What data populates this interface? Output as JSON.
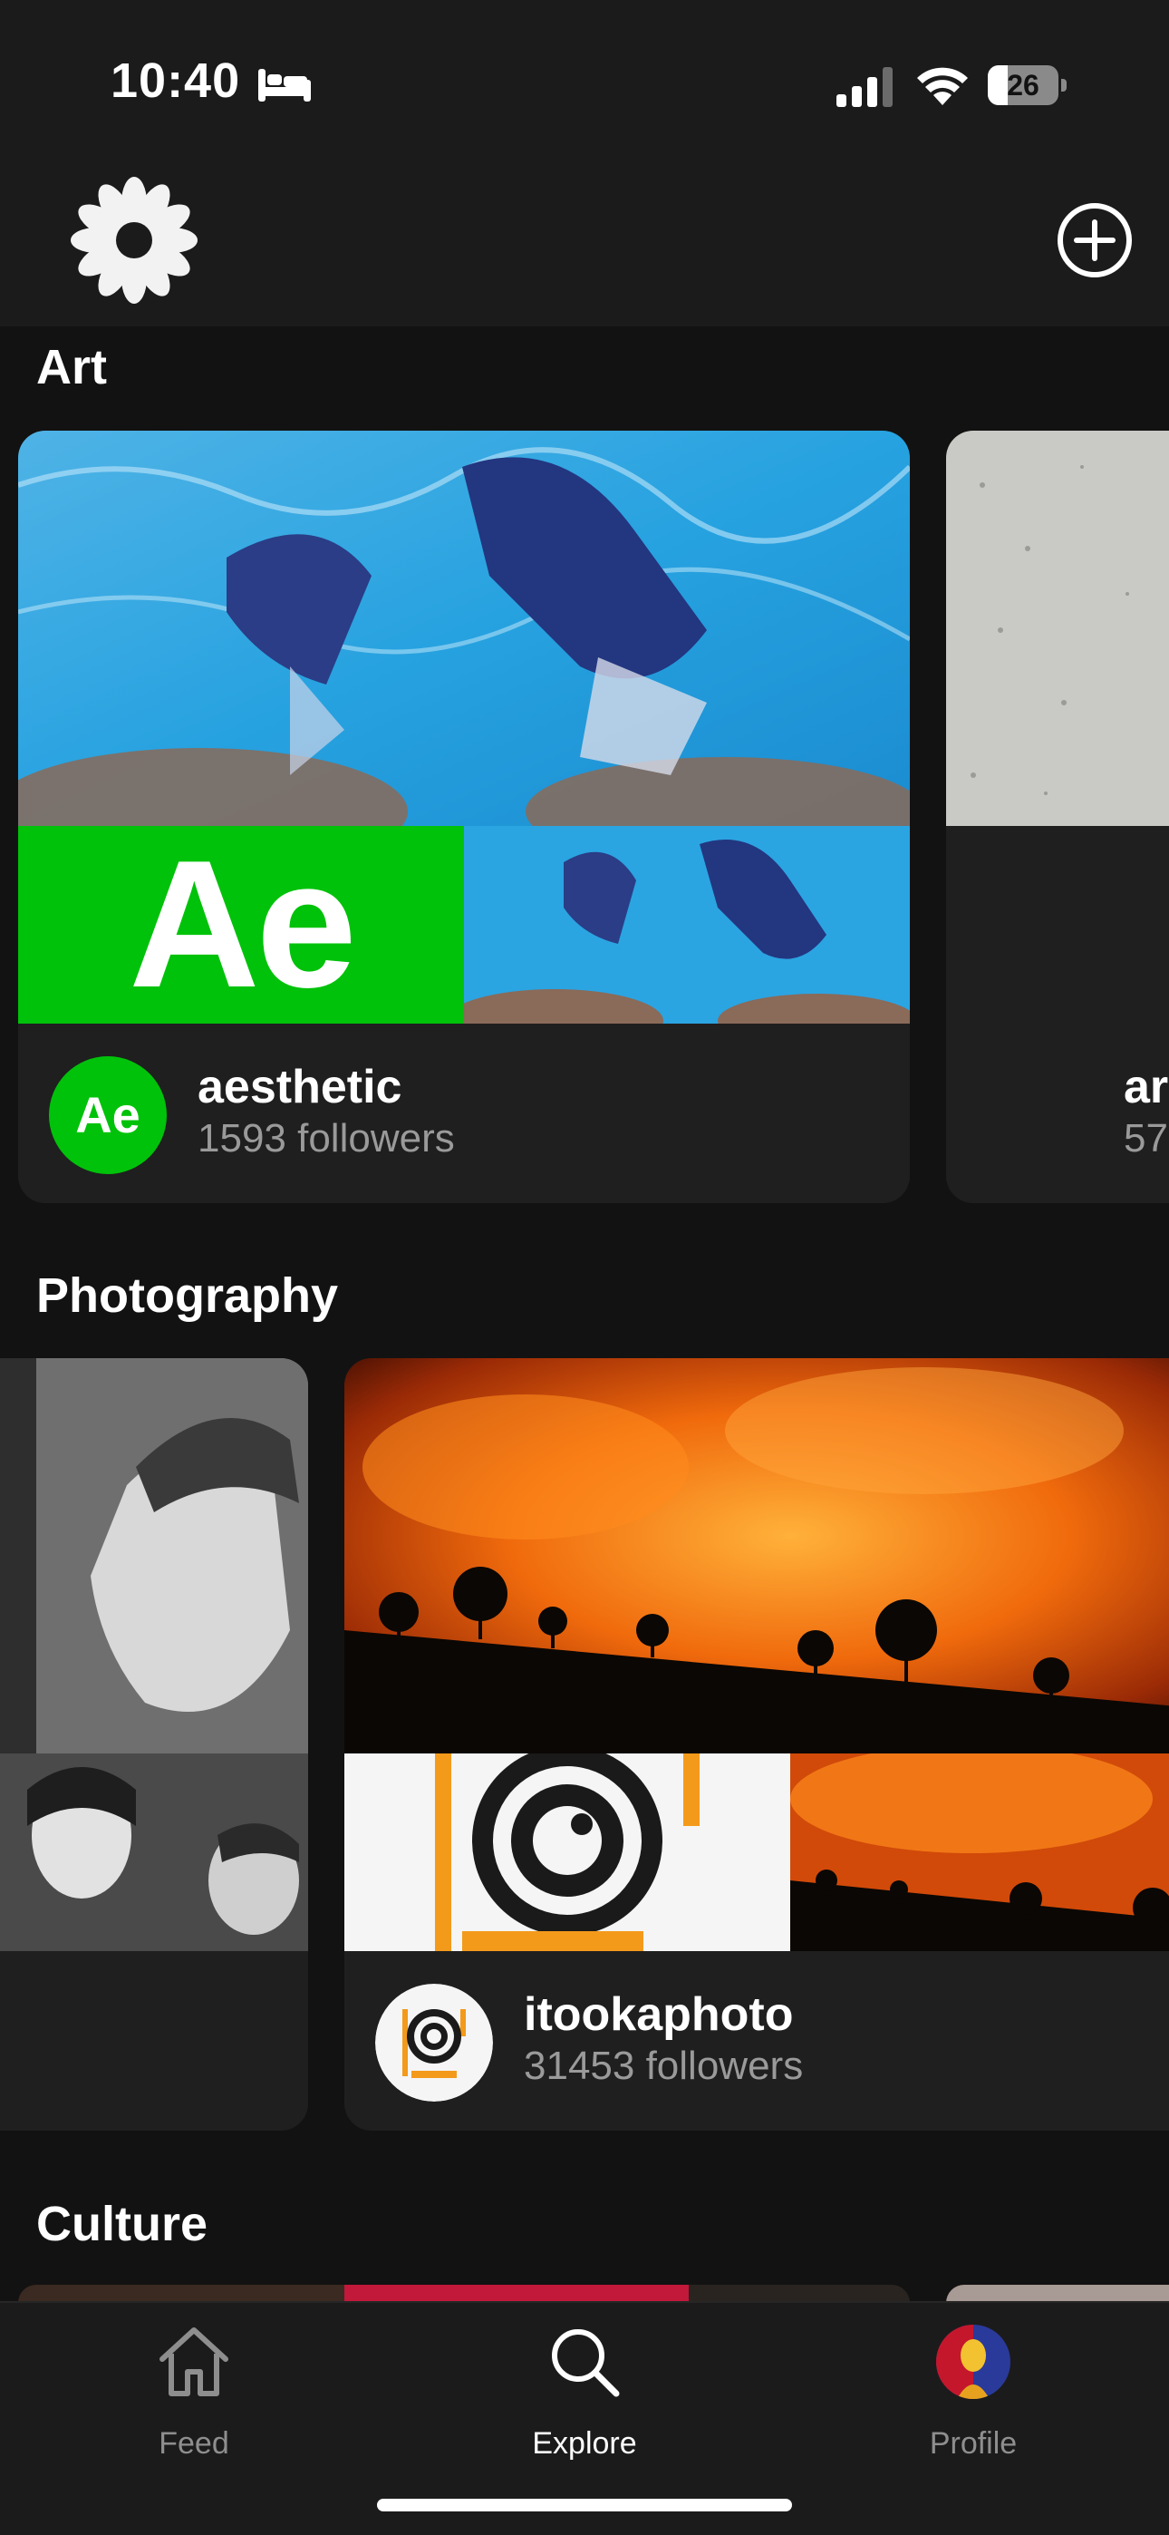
{
  "status_bar": {
    "time": "10:40",
    "battery_level": "26",
    "icons": [
      "bed-icon",
      "signal-icon",
      "wifi-icon",
      "battery-icon"
    ]
  },
  "header": {
    "logo_icon": "swirl-logo-icon",
    "add_icon": "plus-circle-icon"
  },
  "sections": [
    {
      "title": "Art",
      "cards": [
        {
          "name": "aesthetic",
          "followers": "1593 followers",
          "avatar_text": "Ae",
          "logo_text": "Ae",
          "accent": "#00c20a"
        },
        {
          "name": "ar",
          "followers": "57"
        }
      ]
    },
    {
      "title": "Photography",
      "cards": [
        {
          "name": "",
          "followers": ""
        },
        {
          "name": "itookaphoto",
          "followers": "31453 followers",
          "accent": "#f39a1b"
        }
      ]
    },
    {
      "title": "Culture",
      "cards": []
    }
  ],
  "tab_bar": {
    "items": [
      {
        "label": "Feed",
        "icon": "home-icon",
        "active": false
      },
      {
        "label": "Explore",
        "icon": "search-icon",
        "active": true
      },
      {
        "label": "Profile",
        "icon": "avatar-icon",
        "active": false
      }
    ]
  },
  "colors": {
    "background": "#121212",
    "surface": "#1f1f1f",
    "bar": "#1b1b1b",
    "muted_text": "#9a9a9a",
    "inactive_tab": "#8e8e8e",
    "active_tab": "#ffffff"
  }
}
